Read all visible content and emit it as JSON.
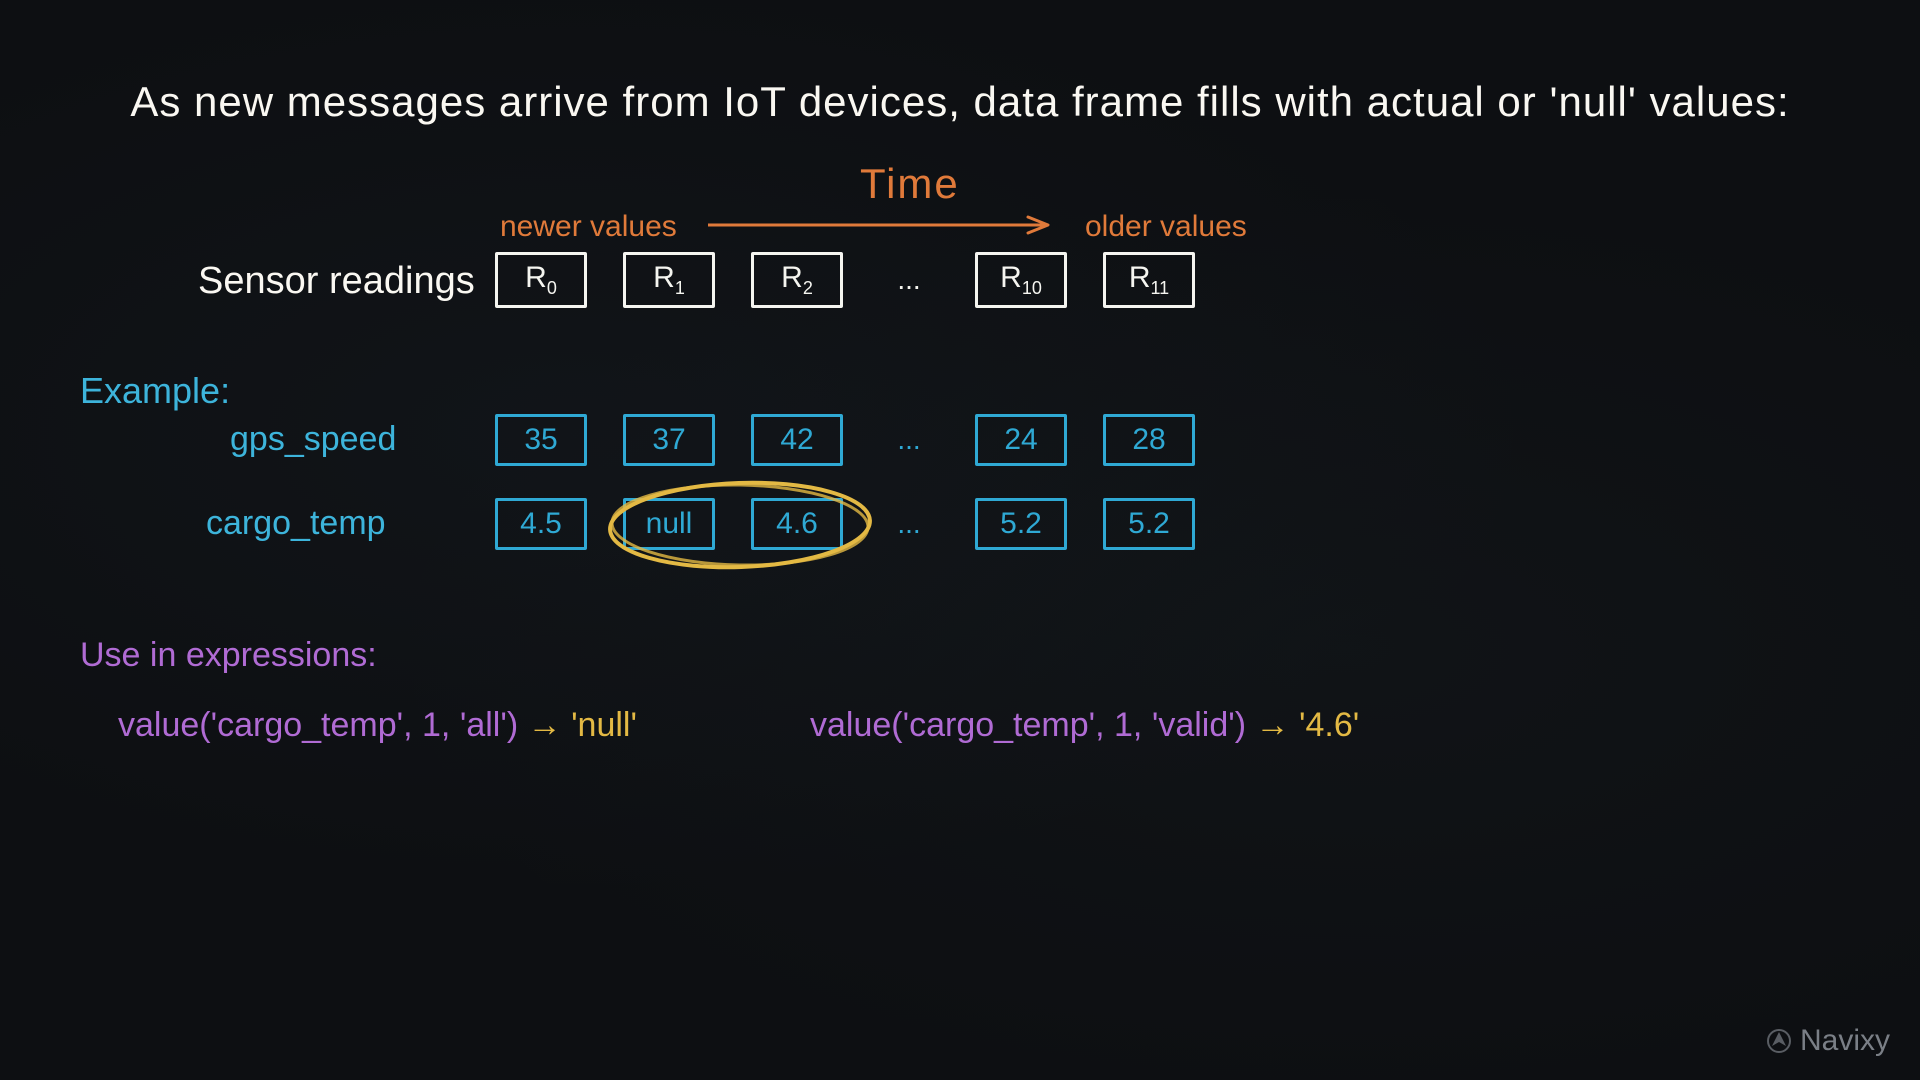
{
  "title": "As new messages arrive from IoT devices, data frame fills with actual or 'null' values:",
  "time_label": "Time",
  "newer_label": "newer values",
  "older_label": "older values",
  "sensor_readings_label": "Sensor readings",
  "readings": {
    "r0": "R",
    "s0": "0",
    "r1": "R",
    "s1": "1",
    "r2": "R",
    "s2": "2",
    "dots": "...",
    "r10": "R",
    "s10": "10",
    "r11": "R",
    "s11": "11"
  },
  "example_label": "Example:",
  "gps": {
    "label": "gps_speed",
    "v0": "35",
    "v1": "37",
    "v2": "42",
    "dots": "...",
    "v10": "24",
    "v11": "28"
  },
  "cargo": {
    "label": "cargo_temp",
    "v0": "4.5",
    "v1": "null",
    "v2": "4.6",
    "dots": "...",
    "v10": "5.2",
    "v11": "5.2"
  },
  "use_expr_label": "Use in expressions:",
  "expr1": {
    "fn": "value('cargo_temp', 1, 'all')",
    "arrow": " → ",
    "result": "'null'"
  },
  "expr2": {
    "fn": "value('cargo_temp', 1, 'valid')",
    "arrow": " → ",
    "result": "'4.6'"
  },
  "brand": "Navixy"
}
